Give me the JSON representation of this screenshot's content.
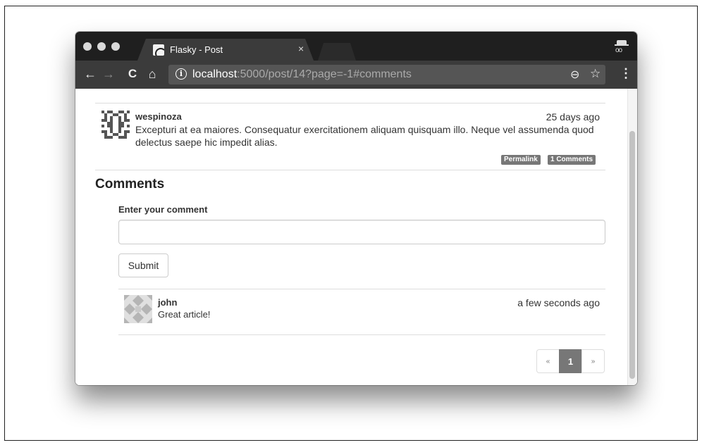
{
  "browser": {
    "tab_title": "Flasky - Post",
    "tab_close": "×",
    "url_host": "localhost",
    "url_rest": ":5000/post/14?page=-1#comments",
    "nav_back": "←",
    "nav_forward": "→",
    "nav_reload": "C",
    "nav_home": "⌂",
    "info_glyph": "i",
    "zoom_glyph": "⊖",
    "star_glyph": "☆",
    "menu_glyph": "⋮"
  },
  "post": {
    "author": "wespinoza",
    "date": "25 days ago",
    "body": "Excepturi at ea maiores. Consequatur exercitationem aliquam quisquam illo. Neque vel assumenda quod delectus saepe hic impedit alias.",
    "permalink_label": "Permalink",
    "comments_label": "1 Comments"
  },
  "comments_section": {
    "heading": "Comments",
    "form_label": "Enter your comment",
    "input_value": "",
    "submit_label": "Submit"
  },
  "comments": [
    {
      "author": "john",
      "date": "a few seconds ago",
      "body": "Great article!"
    }
  ],
  "pagination": {
    "prev": "«",
    "current": "1",
    "next": "»"
  },
  "colors": {
    "tabbar": "#1f1f1f",
    "toolbar": "#3b3b3b",
    "label_bg": "#777777",
    "active_page": "#777777"
  }
}
